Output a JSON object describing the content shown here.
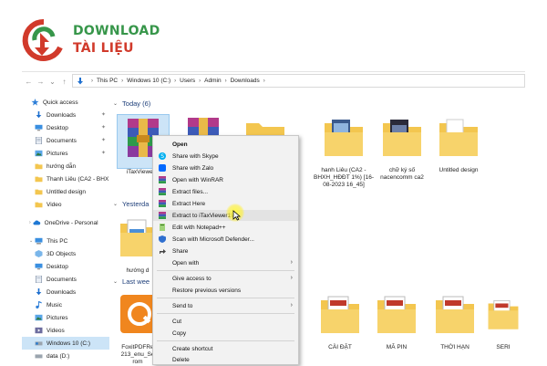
{
  "logo": {
    "line1": "DOWNLOAD",
    "line2": "TÀI LIỆU"
  },
  "address": {
    "crumbs": [
      "This PC",
      "Windows 10 (C:)",
      "Users",
      "Admin",
      "Downloads"
    ]
  },
  "sidebar": {
    "items": [
      {
        "label": "Quick access",
        "icon": "star-icon"
      },
      {
        "label": "Downloads",
        "icon": "download-arrow-icon",
        "pinned": true
      },
      {
        "label": "Desktop",
        "icon": "desktop-icon",
        "pinned": true
      },
      {
        "label": "Documents",
        "icon": "documents-icon",
        "pinned": true
      },
      {
        "label": "Pictures",
        "icon": "pictures-icon",
        "pinned": true
      },
      {
        "label": "hướng dẫn",
        "icon": "folder-icon"
      },
      {
        "label": "Thanh Liêu (CA2 - BHX",
        "icon": "folder-icon"
      },
      {
        "label": "Untitled design",
        "icon": "folder-icon"
      },
      {
        "label": "Video",
        "icon": "folder-icon"
      },
      {
        "label": "OneDrive - Personal",
        "icon": "cloud-icon"
      },
      {
        "label": "This PC",
        "icon": "pc-icon"
      },
      {
        "label": "3D Objects",
        "icon": "3d-objects-icon"
      },
      {
        "label": "Desktop",
        "icon": "desktop-icon"
      },
      {
        "label": "Documents",
        "icon": "documents-icon"
      },
      {
        "label": "Downloads",
        "icon": "download-arrow-icon"
      },
      {
        "label": "Music",
        "icon": "music-icon"
      },
      {
        "label": "Pictures",
        "icon": "pictures-icon"
      },
      {
        "label": "Videos",
        "icon": "videos-icon"
      },
      {
        "label": "Windows 10 (C:)",
        "icon": "drive-icon",
        "selected": true
      },
      {
        "label": "data (D:)",
        "icon": "drive-icon"
      }
    ]
  },
  "groups": {
    "today": "Today (6)",
    "yesterday": "Yesterda",
    "last_week": "Last wee"
  },
  "files": {
    "today": [
      {
        "label": "iTaxViewer 1",
        "icon": "winrar-archive-icon",
        "selected": true
      },
      {
        "label": "",
        "icon": "winrar-archive-icon"
      },
      {
        "label": "",
        "icon": "folder-icon"
      },
      {
        "label": "hanh Liêu (CA2 - BHXH_HĐĐT 1%) [16-08-2023 16_45]",
        "icon": "folder-documents-icon"
      },
      {
        "label": "chữ ký số nacencomm ca2",
        "icon": "folder-documents-icon"
      },
      {
        "label": "Untitled design",
        "icon": "folder-icon"
      }
    ],
    "yesterday": [
      {
        "label": "hướng d",
        "icon": "folder-documents-icon"
      }
    ],
    "last_week": [
      {
        "label": "FoxitPDFRe 213_enu_Se rom",
        "icon": "foxit-installer-icon"
      },
      {
        "label": "CÀI ĐẶT",
        "icon": "folder-documents-icon"
      },
      {
        "label": "MÃ PIN",
        "icon": "folder-documents-icon"
      },
      {
        "label": "THỜI HẠN",
        "icon": "folder-documents-icon"
      },
      {
        "label": "SERI",
        "icon": "folder-documents-icon"
      }
    ]
  },
  "context_menu": {
    "items": [
      {
        "label": "Open"
      },
      {
        "label": "Share with Skype",
        "icon": "skype-icon"
      },
      {
        "label": "Share with Zalo",
        "icon": "zalo-icon"
      },
      {
        "label": "Open with WinRAR",
        "icon": "winrar-icon"
      },
      {
        "label": "Extract files...",
        "icon": "winrar-icon"
      },
      {
        "label": "Extract Here",
        "icon": "winrar-icon"
      },
      {
        "label": "Extract to iTaxViewer1\\",
        "icon": "winrar-icon",
        "hover": true
      },
      {
        "label": "Edit with Notepad++",
        "icon": "notepadpp-icon"
      },
      {
        "label": "Scan with Microsoft Defender...",
        "icon": "defender-icon"
      },
      {
        "label": "Share",
        "icon": "share-icon"
      },
      {
        "label": "Open with",
        "submenu": true
      },
      {
        "label": "Give access to",
        "submenu": true
      },
      {
        "label": "Restore previous versions"
      },
      {
        "label": "Send to",
        "submenu": true
      },
      {
        "label": "Cut"
      },
      {
        "label": "Copy"
      },
      {
        "label": "Create shortcut"
      },
      {
        "label": "Delete"
      }
    ]
  },
  "colors": {
    "accent_blue": "#1e6fcf",
    "selection": "#cce4f7",
    "folder_yellow": "#f3c64f",
    "logo_green": "#37964a",
    "logo_red": "#d13a2b"
  }
}
